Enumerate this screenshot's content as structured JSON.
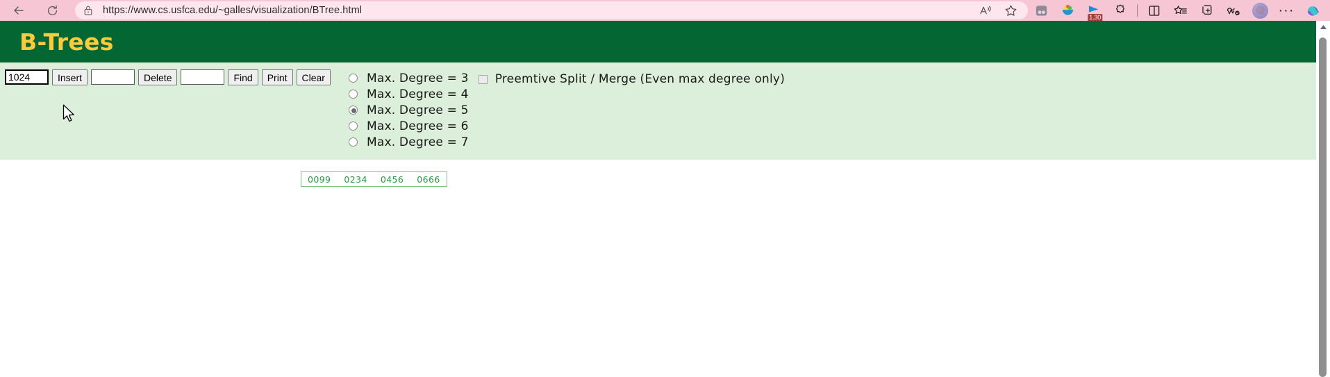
{
  "browser": {
    "back_icon": "back-arrow-icon",
    "reload_icon": "reload-icon",
    "lock_icon": "lock-icon",
    "url": "https://www.cs.usfca.edu/~galles/visualization/BTree.html",
    "read_aloud_icon": "read-aloud-icon",
    "favorite_icon": "star-icon",
    "toolbar_icons": [
      {
        "name": "split-screen-icon",
        "badge": ""
      },
      {
        "name": "shopping-icon",
        "badge": ""
      },
      {
        "name": "video-play-icon",
        "badge": "1.30"
      },
      {
        "name": "browser-essentials-icon",
        "badge": ""
      },
      {
        "name": "split-screen-toggle-icon",
        "badge": ""
      },
      {
        "name": "favorites-list-icon",
        "badge": ""
      },
      {
        "name": "collections-icon",
        "badge": ""
      },
      {
        "name": "performance-icon",
        "badge": ""
      }
    ],
    "profile_icon": "profile-avatar",
    "settings_icon": "more-options-icon",
    "copilot_icon": "copilot-icon"
  },
  "page": {
    "title": "B-Trees",
    "title_color": "#fbcb3d",
    "header_bg": "#046633",
    "controls_bg": "#dcefda"
  },
  "controls": {
    "insert_value": "1024",
    "insert_label": "Insert",
    "delete_value": "",
    "delete_label": "Delete",
    "find_value": "",
    "find_label": "Find",
    "print_label": "Print",
    "clear_label": "Clear",
    "degree_options": [
      {
        "label": "Max. Degree = 3",
        "checked": false
      },
      {
        "label": "Max. Degree = 4",
        "checked": false
      },
      {
        "label": "Max. Degree = 5",
        "checked": true
      },
      {
        "label": "Max. Degree = 6",
        "checked": false
      },
      {
        "label": "Max. Degree = 7",
        "checked": false
      }
    ],
    "preemptive_label": "Preemtive Split / Merge (Even max degree only)",
    "preemptive_checked": false
  },
  "tree": {
    "node_keys": [
      "0099",
      "0234",
      "0456",
      "0666"
    ],
    "key_color": "#1f9e3f",
    "border_color": "#7fbf7f"
  },
  "cursor": {
    "name": "mouse-pointer"
  }
}
